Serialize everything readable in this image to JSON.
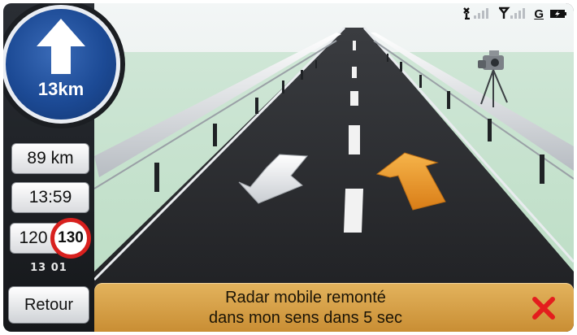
{
  "navigation": {
    "next_maneuver_icon": "straight-arrow-icon",
    "distance": "13km"
  },
  "sidebar": {
    "remaining_distance": "89 km",
    "arrival_time": "13:59",
    "current_speed": "120",
    "speed_limit": "130",
    "date": "13 01",
    "back_label": "Retour"
  },
  "status_bar": {
    "icons": [
      "satellite-signal-icon",
      "gsm-signal-icon",
      "gprs-icon",
      "battery-icon"
    ],
    "gprs_label": "G"
  },
  "alert": {
    "line1": "Radar mobile remonté",
    "line2": "dans mon sens dans 5 sec",
    "close_icon": "close-icon"
  },
  "colors": {
    "nav_blue": "#1c4a95",
    "alert_orange": "#d8a24a",
    "limit_red": "#d8201e",
    "arrow_orange": "#e9922a"
  }
}
